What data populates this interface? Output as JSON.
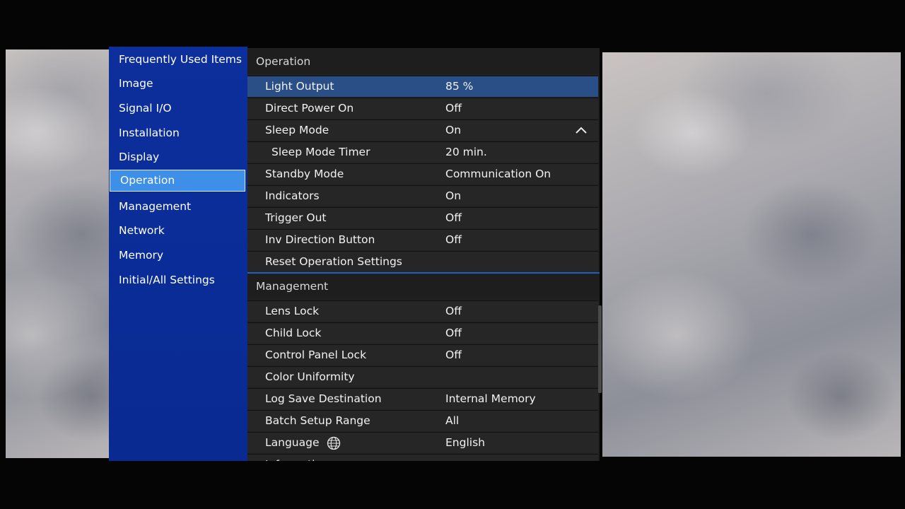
{
  "sidebar": {
    "items": [
      {
        "label": "Frequently Used Items"
      },
      {
        "label": "Image"
      },
      {
        "label": "Signal I/O"
      },
      {
        "label": "Installation"
      },
      {
        "label": "Display"
      },
      {
        "label": "Operation"
      },
      {
        "label": "Management"
      },
      {
        "label": "Network"
      },
      {
        "label": "Memory"
      },
      {
        "label": "Initial/All Settings"
      }
    ],
    "selected": "Operation"
  },
  "operation": {
    "title": "Operation",
    "rows": [
      {
        "label": "Light Output",
        "value": "85 %"
      },
      {
        "label": "Direct Power On",
        "value": "Off"
      },
      {
        "label": "Sleep Mode",
        "value": "On"
      },
      {
        "label": "Sleep Mode Timer",
        "value": "20 min."
      },
      {
        "label": "Standby Mode",
        "value": "Communication On"
      },
      {
        "label": "Indicators",
        "value": "On"
      },
      {
        "label": "Trigger Out",
        "value": "Off"
      },
      {
        "label": "Inv Direction Button",
        "value": "Off"
      },
      {
        "label": "Reset Operation Settings",
        "value": ""
      }
    ]
  },
  "management": {
    "title": "Management",
    "rows": [
      {
        "label": "Lens Lock",
        "value": "Off"
      },
      {
        "label": "Child Lock",
        "value": "Off"
      },
      {
        "label": "Control Panel Lock",
        "value": "Off"
      },
      {
        "label": "Color Uniformity",
        "value": ""
      },
      {
        "label": "Log Save Destination",
        "value": "Internal Memory"
      },
      {
        "label": "Batch Setup Range",
        "value": "All"
      },
      {
        "label": "Language",
        "value": "English"
      },
      {
        "label": "Information",
        "value": ""
      }
    ]
  },
  "icons": {
    "collapse": "chevron-up-icon",
    "language": "globe-icon"
  },
  "colors": {
    "sidebar": "#0c2f9c",
    "selected": "#3d8fe8",
    "active_row": "#2a4f86",
    "row": "#262626"
  }
}
